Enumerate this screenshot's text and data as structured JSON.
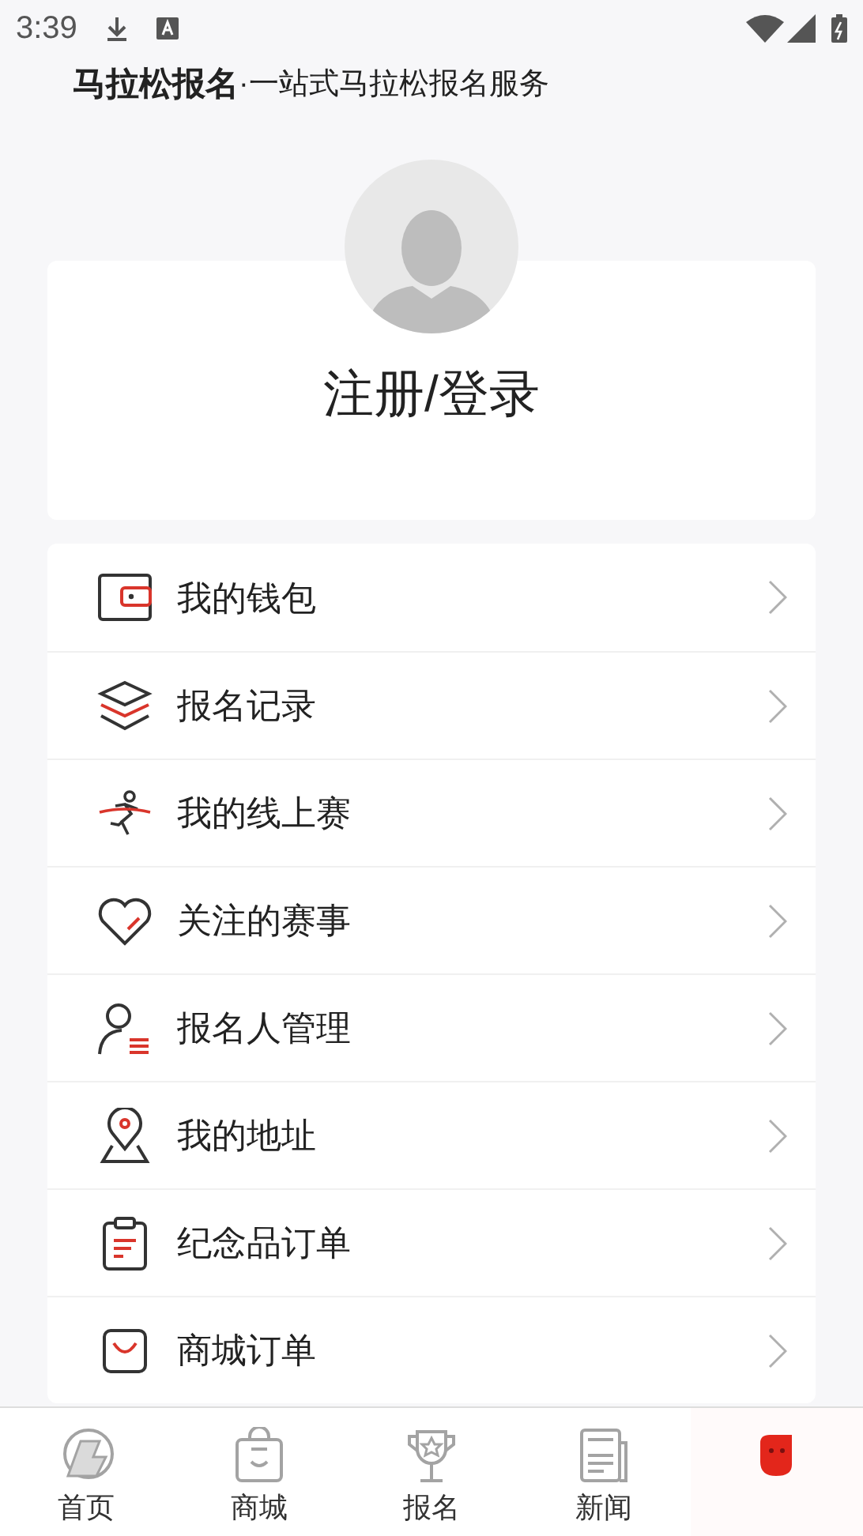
{
  "status_bar": {
    "time": "3:39"
  },
  "header": {
    "app_name": "马拉松报名",
    "tagline": "·一站式马拉松报名服务"
  },
  "profile": {
    "login": "注册/登录"
  },
  "menu": [
    {
      "label": "我的钱包"
    },
    {
      "label": "报名记录"
    },
    {
      "label": "我的线上赛"
    },
    {
      "label": "关注的赛事"
    },
    {
      "label": "报名人管理"
    },
    {
      "label": "我的地址"
    },
    {
      "label": "纪念品订单"
    },
    {
      "label": "商城订单"
    }
  ],
  "tab_bar": [
    {
      "label": "首页",
      "selected": false
    },
    {
      "label": "商城",
      "selected": false
    },
    {
      "label": "报名",
      "selected": false
    },
    {
      "label": "新闻",
      "selected": false
    },
    {
      "selected": true
    }
  ]
}
